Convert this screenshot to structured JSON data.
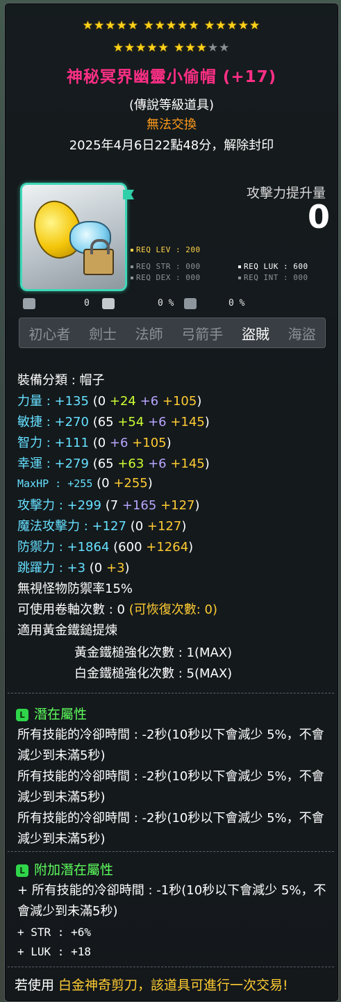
{
  "stars": {
    "row1": "★★★★★ ★★★★★ ★★★★★",
    "row2_on": "★★★★★ ★★★",
    "row2_off": "★★"
  },
  "item": {
    "name": "神秘冥界幽靈小偷帽 (+17)",
    "grade": "(傳說等級道具)",
    "trade": "無法交換",
    "seal": "2025年4月6日22點48分，解除封印"
  },
  "attack_gain": {
    "label": "攻擊力提升量",
    "value": "0"
  },
  "requirements": {
    "lev": "REQ LEV : 200",
    "str": "REQ STR : 000",
    "luk": "REQ LUK : 600",
    "dex": "REQ DEX : 000",
    "int": "REQ INT : 000"
  },
  "small_values": {
    "a": "0",
    "b": "0 %",
    "c": "0 %"
  },
  "jobs": [
    "初心者",
    "劍士",
    "法師",
    "弓箭手",
    "盜賊",
    "海盜"
  ],
  "stats": {
    "category": "裝備分類 : 帽子",
    "str": {
      "label": "力量 : +135",
      "base": "(0 ",
      "g": "+24",
      "p": " +6",
      "o": " +105",
      "end": ")"
    },
    "dex": {
      "label": "敏捷 : +270",
      "base": "(65 ",
      "g": "+54",
      "p": " +6",
      "o": " +145",
      "end": ")"
    },
    "int": {
      "label": "智力 : +111",
      "base": "(0 ",
      "p": "+6",
      "o": " +105",
      "end": ")"
    },
    "luk": {
      "label": "幸運 : +279",
      "base": "(65 ",
      "g": "+63",
      "p": " +6",
      "o": " +145",
      "end": ")"
    },
    "hp": {
      "label": "MaxHP : +255",
      "base": "(0 ",
      "o": "+255",
      "end": ")"
    },
    "atk": {
      "label": "攻擊力 : +299",
      "base": "(7 ",
      "p": "+165",
      "o": " +127",
      "end": ")"
    },
    "matk": {
      "label": "魔法攻擊力 : +127",
      "base": "(0 ",
      "o": "+127",
      "end": ")"
    },
    "def": {
      "label": "防禦力 : +1864",
      "base": "(600 ",
      "o": "+1264",
      "end": ")"
    },
    "jump": {
      "label": "跳躍力 : +3",
      "base": "(0 ",
      "o": "+3",
      "end": ")"
    },
    "ignore": "無視怪物防禦率15%",
    "scroll": "可使用卷軸次數 : 0",
    "scroll_recover": "(可恢復次數: 0)",
    "hammer": "適用黃金鐵鎚提煉",
    "gold_hammer": "黃金鐵槌強化次數 : 1(MAX)",
    "plat_hammer": "白金鐵槌強化次數 : 5(MAX)"
  },
  "potential": {
    "badge": "L",
    "title": "潛在屬性",
    "lines": [
      "所有技能的冷卻時間 : -2秒(10秒以下會減少 5%，不會減少到未滿5秒)",
      "所有技能的冷卻時間 : -2秒(10秒以下會減少 5%，不會減少到未滿5秒)",
      "所有技能的冷卻時間 : -2秒(10秒以下會減少 5%，不會減少到未滿5秒)"
    ]
  },
  "additional": {
    "badge": "L",
    "title": "附加潛在屬性",
    "line1": "+ 所有技能的冷卻時間 : -1秒(10秒以下會減少 5%，不會減少到未滿5秒)",
    "line2": "+ STR : +6%",
    "line3": "+ LUK : +18"
  },
  "footer": {
    "pre": "若使用 ",
    "hl": "白金神奇剪刀，該道具可進行一次交易!"
  },
  "colors": {
    "title": "#ff2f86",
    "stat_blue": "#66e0ff",
    "green": "#ccff33",
    "purple": "#b9a6ff",
    "orange": "#ffcc33",
    "potential": "#5dff5d"
  }
}
